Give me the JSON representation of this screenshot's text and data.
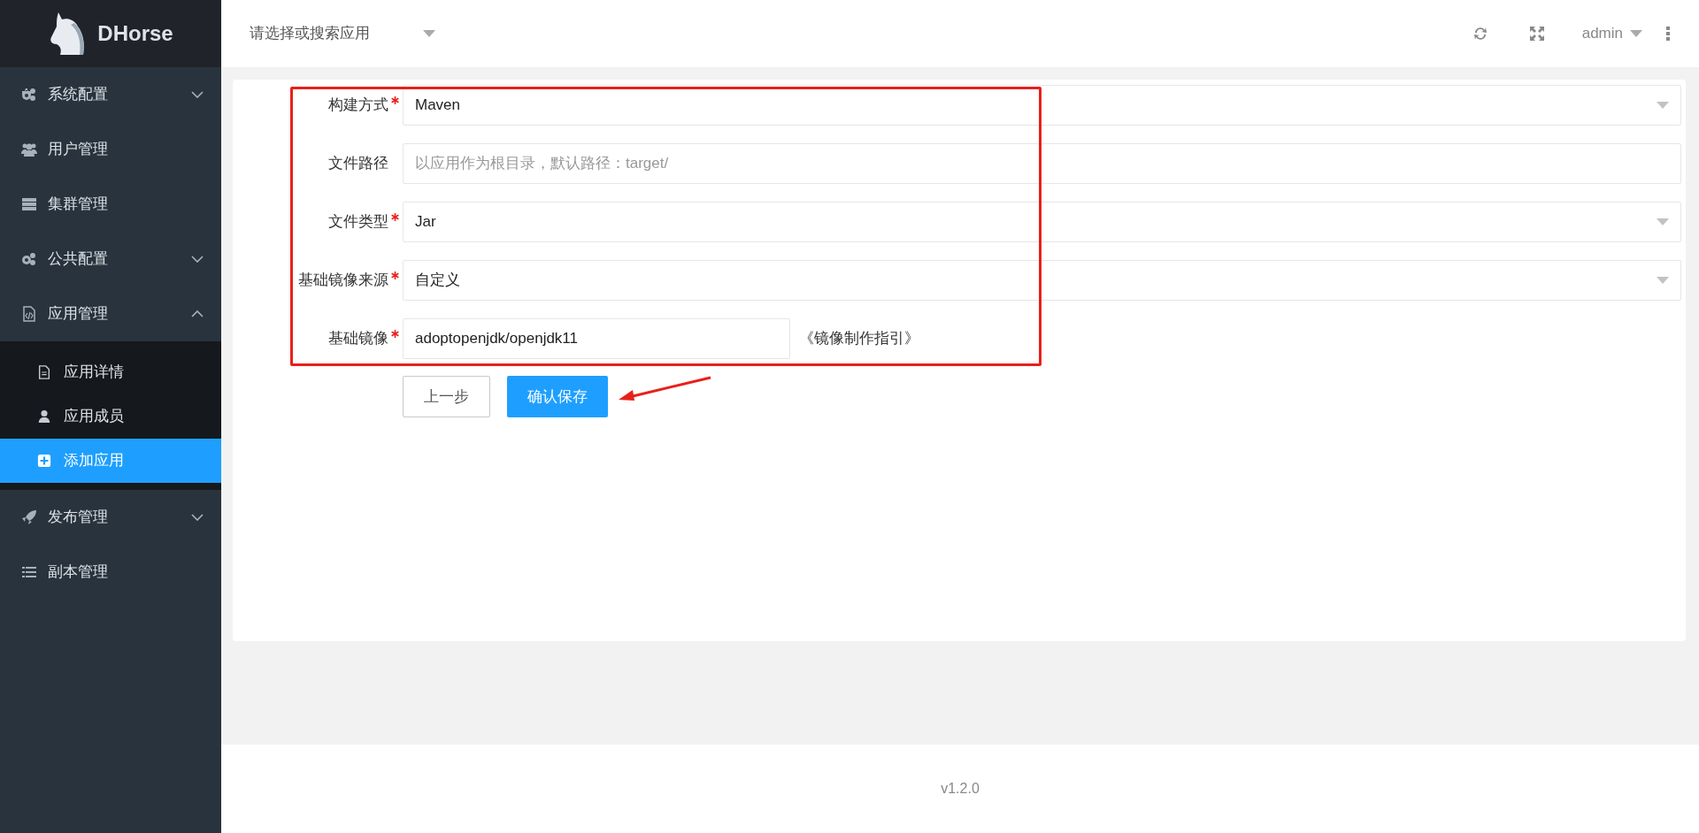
{
  "app": {
    "name": "DHorse"
  },
  "header": {
    "app_select": {
      "placeholder": "请选择或搜索应用"
    },
    "user": "admin"
  },
  "sidebar": {
    "items": [
      {
        "label": "系统配置",
        "kind": "group",
        "expanded": false
      },
      {
        "label": "用户管理",
        "kind": "link"
      },
      {
        "label": "集群管理",
        "kind": "link"
      },
      {
        "label": "公共配置",
        "kind": "group",
        "expanded": false
      },
      {
        "label": "应用管理",
        "kind": "group",
        "expanded": true,
        "children": [
          {
            "label": "应用详情",
            "selected": false
          },
          {
            "label": "应用成员",
            "selected": false
          },
          {
            "label": "添加应用",
            "selected": true
          }
        ]
      },
      {
        "label": "发布管理",
        "kind": "group",
        "expanded": false
      },
      {
        "label": "副本管理",
        "kind": "link"
      }
    ]
  },
  "form": {
    "fields": [
      {
        "label": "构建方式",
        "required": true,
        "kind": "select",
        "value": "Maven"
      },
      {
        "label": "文件路径",
        "required": false,
        "kind": "input",
        "placeholder": "以应用作为根目录，默认路径：target/"
      },
      {
        "label": "文件类型",
        "required": true,
        "kind": "select",
        "value": "Jar"
      },
      {
        "label": "基础镜像来源",
        "required": true,
        "kind": "select",
        "value": "自定义"
      },
      {
        "label": "基础镜像",
        "required": true,
        "kind": "short_input",
        "value": "adoptopenjdk/openjdk11",
        "link": "《镜像制作指引》"
      }
    ],
    "buttons": [
      {
        "label": "上一步",
        "primary": false
      },
      {
        "label": "确认保存",
        "primary": true
      }
    ]
  },
  "footer": {
    "version": "v1.2.0"
  }
}
